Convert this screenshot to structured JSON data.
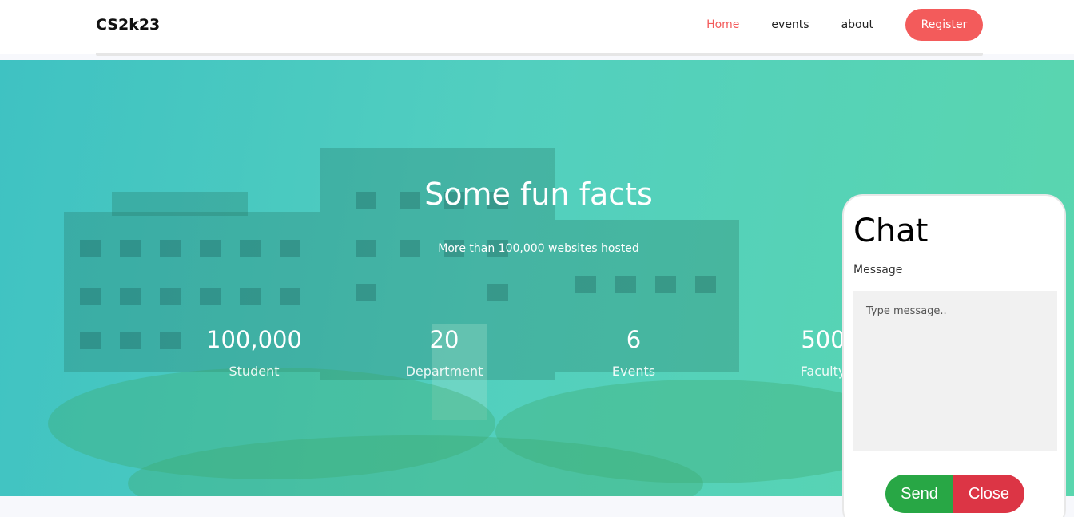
{
  "header": {
    "logo": "CS2k23",
    "nav": {
      "home": "Home",
      "events": "events",
      "about": "about",
      "register": "Register"
    }
  },
  "hero": {
    "title": "Some fun facts",
    "subtitle": "More than 100,000 websites hosted",
    "stats": [
      {
        "value": "100,000",
        "label": "Student"
      },
      {
        "value": "20",
        "label": "Department"
      },
      {
        "value": "6",
        "label": "Events"
      },
      {
        "value": "500",
        "label": "Faculty"
      }
    ]
  },
  "chat": {
    "title": "Chat",
    "message_label": "Message",
    "placeholder": "Type message..",
    "send_label": "Send",
    "close_label": "Close"
  },
  "colors": {
    "accent": "#f35b5b",
    "hero_start": "#3fc2c2",
    "hero_end": "#5ad6ae",
    "send": "#28a745",
    "close": "#dc3545"
  }
}
